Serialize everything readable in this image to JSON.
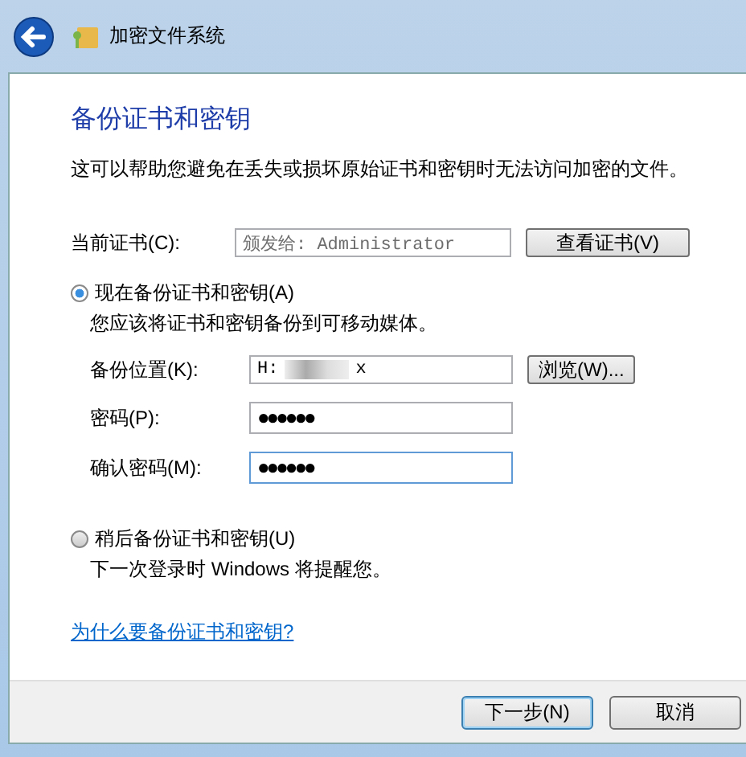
{
  "window": {
    "title": "加密文件系统"
  },
  "heading": "备份证书和密钥",
  "description": "这可以帮助您避免在丢失或损坏原始证书和密钥时无法访问加密的文件。",
  "current_certificate": {
    "label": "当前证书(C):",
    "value": "颁发给:  Administrator",
    "button": "查看证书(V)"
  },
  "options": [
    {
      "label": "现在备份证书和密钥(A)",
      "note": "您应该将证书和密钥备份到可移动媒体。",
      "selected": true
    },
    {
      "label": "稍后备份证书和密钥(U)",
      "note": "下一次登录时 Windows 将提醒您。",
      "selected": false
    }
  ],
  "backup_location": {
    "label": "备份位置(K):",
    "value_start": "H:",
    "value_end": "x",
    "button": "浏览(W)..."
  },
  "password": {
    "label": "密码(P):",
    "value": "●●●●●●"
  },
  "confirm_password": {
    "label": "确认密码(M):",
    "value": "●●●●●●",
    "focused": true
  },
  "link": "为什么要备份证书和密钥?",
  "buttons": [
    {
      "label": "下一步(N)",
      "default": true
    },
    {
      "label": "取消",
      "default": false
    }
  ]
}
